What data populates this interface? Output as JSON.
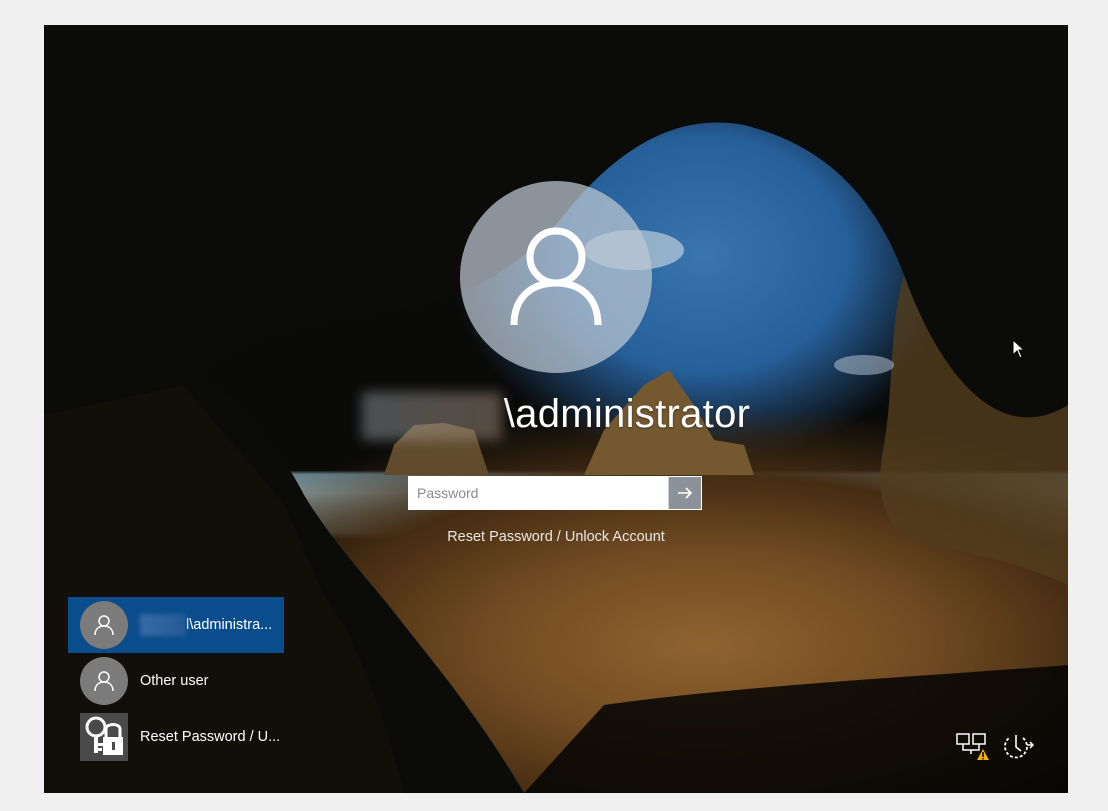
{
  "login": {
    "user_title": "\\administrator",
    "password_placeholder": "Password",
    "reset_link": "Reset Password / Unlock Account"
  },
  "user_list": [
    {
      "label": "l\\administra...",
      "selected": true,
      "icon": "user-avatar-icon"
    },
    {
      "label": "Other user",
      "selected": false,
      "icon": "user-avatar-icon"
    },
    {
      "label": "Reset Password / U...",
      "selected": false,
      "icon": "key-lock-icon"
    }
  ],
  "corner_icons": [
    "network-warning-icon",
    "power-icon"
  ],
  "colors": {
    "selected_item": "#0a4d8c",
    "avatar_circle": "#bec8d2",
    "warning": "#f0b400"
  }
}
